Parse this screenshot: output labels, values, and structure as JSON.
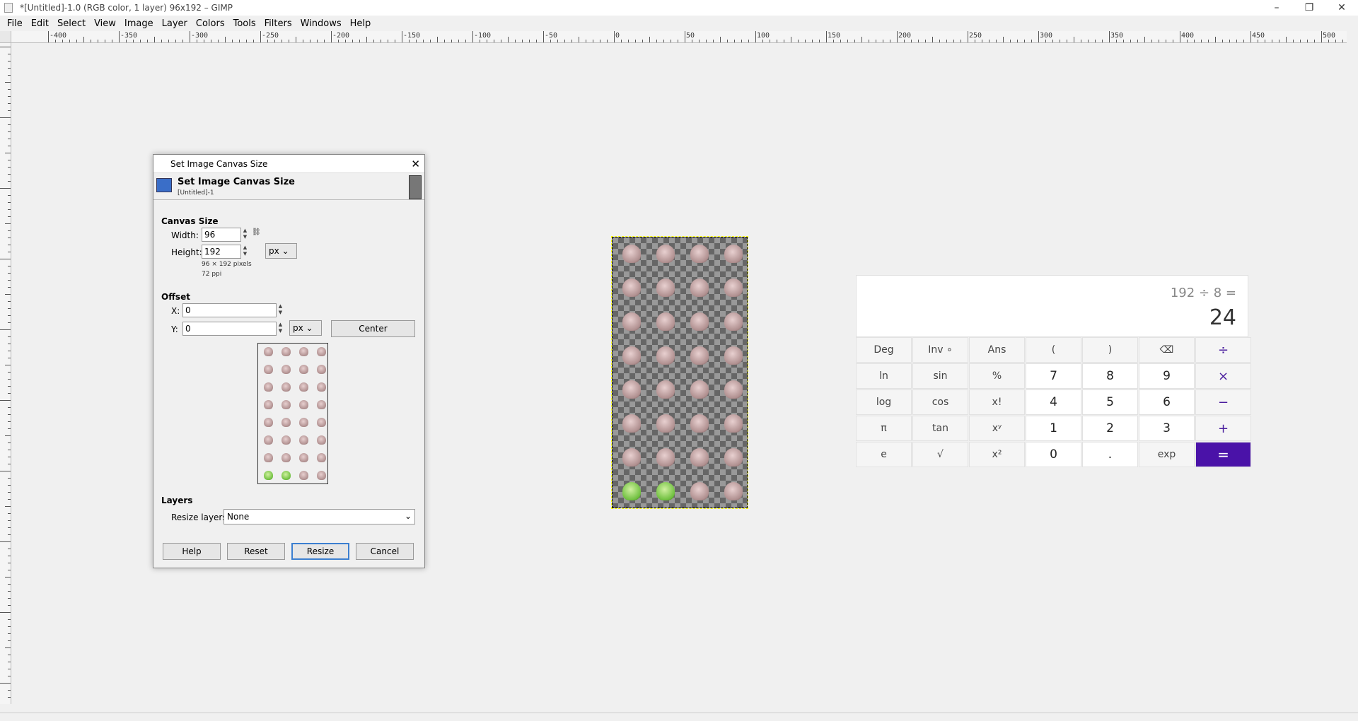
{
  "window": {
    "title": "*[Untitled]-1.0 (RGB color, 1 layer) 96x192 – GIMP",
    "minimize": "–",
    "restore": "❐",
    "close": "✕"
  },
  "menu": [
    "File",
    "Edit",
    "Select",
    "View",
    "Image",
    "Layer",
    "Colors",
    "Tools",
    "Filters",
    "Windows",
    "Help"
  ],
  "ruler": {
    "h_labels": [
      "-400",
      "-350",
      "-300",
      "-250",
      "-200",
      "-150",
      "-100",
      "-50",
      "0",
      "50",
      "100",
      "150",
      "200",
      "250",
      "300",
      "350",
      "400",
      "450",
      "500"
    ]
  },
  "dialog": {
    "window_title": "Set Image Canvas Size",
    "header_title": "Set Image Canvas Size",
    "header_subtitle": "[Untitled]-1",
    "canvas_size_label": "Canvas Size",
    "width_label": "Width:",
    "width_value": "96",
    "height_label": "Height:",
    "height_value": "192",
    "size_unit": "px",
    "pixels_info": "96 × 192 pixels",
    "ppi_info": "72 ppi",
    "offset_label": "Offset",
    "x_label": "X:",
    "x_value": "0",
    "y_label": "Y:",
    "y_value": "0",
    "offset_unit": "px",
    "center_button": "Center",
    "layers_label": "Layers",
    "resize_layers_label": "Resize layers:",
    "resize_layers_value": "None",
    "buttons": {
      "help": "Help",
      "reset": "Reset",
      "resize": "Resize",
      "cancel": "Cancel"
    }
  },
  "calculator": {
    "expression": "192 ÷ 8 =",
    "result": "24",
    "keys": [
      [
        "Deg",
        "Inv ∘",
        "Ans",
        "(",
        ")",
        "⌫",
        "÷"
      ],
      [
        "ln",
        "sin",
        "%",
        "7",
        "8",
        "9",
        "×"
      ],
      [
        "log",
        "cos",
        "x!",
        "4",
        "5",
        "6",
        "−"
      ],
      [
        "π",
        "tan",
        "xʸ",
        "1",
        "2",
        "3",
        "+"
      ],
      [
        "e",
        "√",
        "x²",
        "0",
        ".",
        "exp",
        "="
      ]
    ]
  }
}
